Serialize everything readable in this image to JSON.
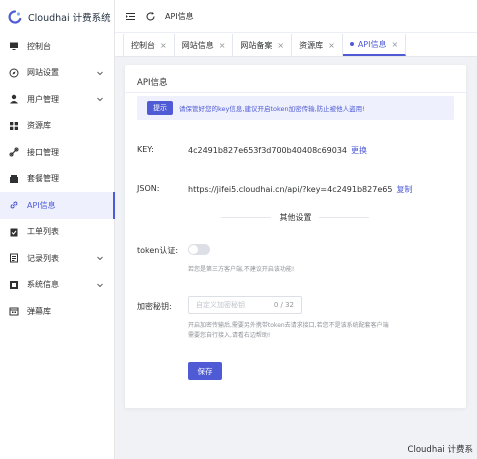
{
  "brand": {
    "name": "Cloudhai 计费系统"
  },
  "sidebar": {
    "items": [
      {
        "label": "控制台",
        "icon": "monitor-icon",
        "expandable": false,
        "active": false
      },
      {
        "label": "网站设置",
        "icon": "compass-icon",
        "expandable": true,
        "active": false
      },
      {
        "label": "用户管理",
        "icon": "user-icon",
        "expandable": true,
        "active": false
      },
      {
        "label": "资源库",
        "icon": "grid-icon",
        "expandable": false,
        "active": false
      },
      {
        "label": "接口管理",
        "icon": "link-icon",
        "expandable": false,
        "active": false
      },
      {
        "label": "套餐管理",
        "icon": "package-icon",
        "expandable": false,
        "active": false
      },
      {
        "label": "API信息",
        "icon": "api-link-icon",
        "expandable": false,
        "active": true
      },
      {
        "label": "工单列表",
        "icon": "clipboard-icon",
        "expandable": false,
        "active": false
      },
      {
        "label": "记录列表",
        "icon": "records-icon",
        "expandable": true,
        "active": false
      },
      {
        "label": "系统信息",
        "icon": "system-icon",
        "expandable": true,
        "active": false
      },
      {
        "label": "弹幕库",
        "icon": "calendar-icon",
        "expandable": false,
        "active": false
      }
    ]
  },
  "header": {
    "breadcrumb": "API信息"
  },
  "tabs": [
    {
      "label": "控制台",
      "active": false
    },
    {
      "label": "网站信息",
      "active": false
    },
    {
      "label": "网站备案",
      "active": false
    },
    {
      "label": "资源库",
      "active": false
    },
    {
      "label": "API信息",
      "active": true
    }
  ],
  "card": {
    "title": "API信息",
    "notice": {
      "tag": "提示",
      "message": "请保管好您的key信息,建议开启token加密传输,防止被他人盗用!"
    },
    "key": {
      "label": "KEY:",
      "value": "4c2491b827e653f3d700b40408c69034",
      "action": "更换"
    },
    "json": {
      "label": "JSON:",
      "value": "https://jifei5.cloudhai.cn/api/?key=4c2491b827e65",
      "action": "复制"
    },
    "section_title": "其他设置",
    "token": {
      "label": "token认证:",
      "enabled": false,
      "hint": "若您是第三方客户端,不建议开启该功能!"
    },
    "secret": {
      "label": "加密秘钥:",
      "placeholder": "自定义加密秘钥",
      "count": "0 / 32",
      "hint_line1": "开启加密传输后,需要另外携带token去请求接口,若您不是该系统配套客户端",
      "hint_line2": "需要您自行接入,请看右边帮助!"
    },
    "save_label": "保存"
  },
  "footer": {
    "text": "Cloudhai 计费系"
  },
  "colors": {
    "accent": "#4f5bd5",
    "notice_bg": "#eef0fe",
    "page_bg": "#f0f2f5"
  }
}
